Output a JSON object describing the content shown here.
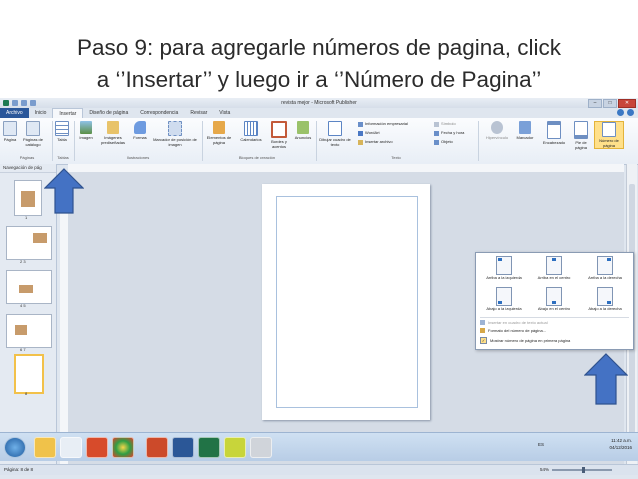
{
  "slide": {
    "title_line1": "Paso 9: para agregarle números de pagina, click",
    "title_line2": "a ‘’Insertar’’ y luego ir a ‘’Número de Pagina’’"
  },
  "window": {
    "title": "revista mejor - Microsoft Publisher",
    "controls": [
      "–",
      "□",
      "✕"
    ]
  },
  "tabs": [
    {
      "label": "Archivo"
    },
    {
      "label": "Inicio"
    },
    {
      "label": "Insertar"
    },
    {
      "label": "Diseño de página"
    },
    {
      "label": "Correspondencia"
    },
    {
      "label": "Revisar"
    },
    {
      "label": "Vista"
    }
  ],
  "ribbon": {
    "pagina": "Página",
    "paginas_catalogo": "Páginas de catálogo",
    "tabla": "Tabla",
    "imagen": "Imagen",
    "imagenes_pred": "Imágenes prediseñadas",
    "formas": "Formas",
    "marcador": "Marcador de posición de imagen",
    "elementos": "Elementos de página",
    "calendarios": "Calendarios",
    "bordes": "Bordes y acentos",
    "anuncios": "Anuncios",
    "dibujar": "Dibujar cuadro de texto",
    "info_empresarial": "Información empresarial",
    "wordart": "WordArt",
    "insertar_archivo": "Insertar archivo",
    "simbolo": "Símbolo",
    "fecha_hora": "Fecha y hora",
    "objeto": "Objeto",
    "hipervinculo": "Hipervínculo",
    "marcador2": "Marcador",
    "encabezado": "Encabezado",
    "pie": "Pie de página",
    "numero_pagina": "Número de página",
    "group_paginas": "Páginas",
    "group_tablas": "Tablas",
    "group_ilustraciones": "Ilustraciones",
    "group_bloques": "Bloques de creación",
    "group_texto": "Texto"
  },
  "nav": {
    "header": "Navegación de pág",
    "page_numbers": [
      "1",
      "2   3",
      "4   5",
      "6   7",
      "8"
    ]
  },
  "dropdown": {
    "items": [
      {
        "label": "Arriba a la izquierda"
      },
      {
        "label": "Arriba en el centro"
      },
      {
        "label": "Arriba a la derecha"
      },
      {
        "label": "Abajo a la izquierda"
      },
      {
        "label": "Abajo en el centro"
      },
      {
        "label": "Abajo a la derecha"
      }
    ],
    "insertar_actual": "Insertar en cuadro de texto actual",
    "formato": "Formato del número de página...",
    "mostrar": "Mostrar número de página en primera página"
  },
  "status": {
    "page_info": "Página: 8 de 8",
    "zoom": "54%"
  },
  "tray": {
    "lang": "ES",
    "time": "11:42 a.m.",
    "date": "04/12/2016"
  },
  "colors": {
    "arrow_blue": "#4472c4",
    "file_tab": "#2a579a",
    "highlight": "#ffe08a"
  }
}
